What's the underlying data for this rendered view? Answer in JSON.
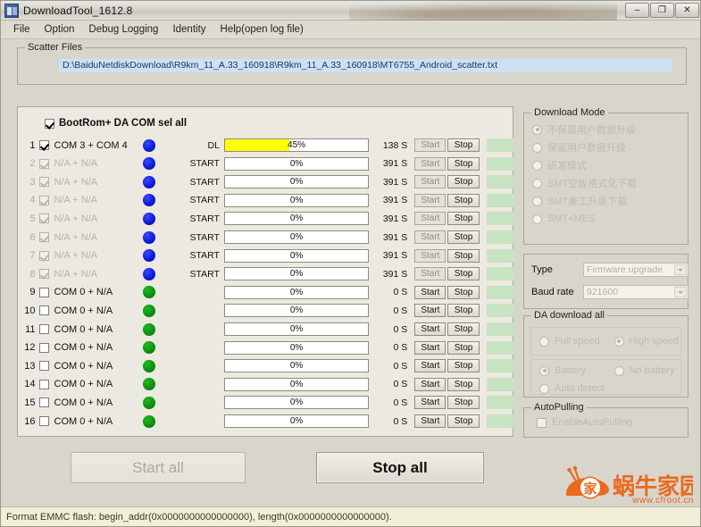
{
  "window": {
    "title": "DownloadTool_1612.8",
    "minimize_label": "–",
    "maximize_label": "❐",
    "close_label": "✕"
  },
  "menu": {
    "items": [
      {
        "label": "File"
      },
      {
        "label": "Option"
      },
      {
        "label": "Debug Logging"
      },
      {
        "label": "Identity"
      },
      {
        "label": "Help(open log file)"
      }
    ]
  },
  "scatter": {
    "group_label": "Scatter Files",
    "path": "D:\\BaiduNetdiskDownload\\R9km_11_A.33_160918\\R9km_11_A.33_160918\\MT6755_Android_scatter.txt"
  },
  "device_panel": {
    "select_all_label": "BootRom+ DA COM sel all",
    "select_all_checked": true,
    "rows": [
      {
        "index": "1",
        "checked": true,
        "dim": false,
        "port": "COM 3 + COM 4",
        "led": "blue",
        "action": "DL",
        "percent": "45%",
        "fill": 45,
        "filled": true,
        "time": "138 S",
        "start": "Start",
        "stop": "Stop",
        "start_enabled": false,
        "stop_enabled": true
      },
      {
        "index": "2",
        "checked": true,
        "dim": true,
        "port": "N/A + N/A",
        "led": "blue",
        "action": "START",
        "percent": "0%",
        "fill": 0,
        "filled": false,
        "time": "391 S",
        "start": "Start",
        "stop": "Stop",
        "start_enabled": false,
        "stop_enabled": true
      },
      {
        "index": "3",
        "checked": true,
        "dim": true,
        "port": "N/A + N/A",
        "led": "blue",
        "action": "START",
        "percent": "0%",
        "fill": 0,
        "filled": false,
        "time": "391 S",
        "start": "Start",
        "stop": "Stop",
        "start_enabled": false,
        "stop_enabled": true
      },
      {
        "index": "4",
        "checked": true,
        "dim": true,
        "port": "N/A + N/A",
        "led": "blue",
        "action": "START",
        "percent": "0%",
        "fill": 0,
        "filled": false,
        "time": "391 S",
        "start": "Start",
        "stop": "Stop",
        "start_enabled": false,
        "stop_enabled": true
      },
      {
        "index": "5",
        "checked": true,
        "dim": true,
        "port": "N/A + N/A",
        "led": "blue",
        "action": "START",
        "percent": "0%",
        "fill": 0,
        "filled": false,
        "time": "391 S",
        "start": "Start",
        "stop": "Stop",
        "start_enabled": false,
        "stop_enabled": true
      },
      {
        "index": "6",
        "checked": true,
        "dim": true,
        "port": "N/A + N/A",
        "led": "blue",
        "action": "START",
        "percent": "0%",
        "fill": 0,
        "filled": false,
        "time": "391 S",
        "start": "Start",
        "stop": "Stop",
        "start_enabled": false,
        "stop_enabled": true
      },
      {
        "index": "7",
        "checked": true,
        "dim": true,
        "port": "N/A + N/A",
        "led": "blue",
        "action": "START",
        "percent": "0%",
        "fill": 0,
        "filled": false,
        "time": "391 S",
        "start": "Start",
        "stop": "Stop",
        "start_enabled": false,
        "stop_enabled": true
      },
      {
        "index": "8",
        "checked": true,
        "dim": true,
        "port": "N/A + N/A",
        "led": "blue",
        "action": "START",
        "percent": "0%",
        "fill": 0,
        "filled": false,
        "time": "391 S",
        "start": "Start",
        "stop": "Stop",
        "start_enabled": false,
        "stop_enabled": true
      },
      {
        "index": "9",
        "checked": false,
        "dim": false,
        "port": "COM 0 + N/A",
        "led": "green",
        "action": "",
        "percent": "0%",
        "fill": 0,
        "filled": false,
        "time": "0 S",
        "start": "Start",
        "stop": "Stop",
        "start_enabled": true,
        "stop_enabled": true
      },
      {
        "index": "10",
        "checked": false,
        "dim": false,
        "port": "COM 0 + N/A",
        "led": "green",
        "action": "",
        "percent": "0%",
        "fill": 0,
        "filled": false,
        "time": "0 S",
        "start": "Start",
        "stop": "Stop",
        "start_enabled": true,
        "stop_enabled": true
      },
      {
        "index": "11",
        "checked": false,
        "dim": false,
        "port": "COM 0 + N/A",
        "led": "green",
        "action": "",
        "percent": "0%",
        "fill": 0,
        "filled": false,
        "time": "0 S",
        "start": "Start",
        "stop": "Stop",
        "start_enabled": true,
        "stop_enabled": true
      },
      {
        "index": "12",
        "checked": false,
        "dim": false,
        "port": "COM 0 + N/A",
        "led": "green",
        "action": "",
        "percent": "0%",
        "fill": 0,
        "filled": false,
        "time": "0 S",
        "start": "Start",
        "stop": "Stop",
        "start_enabled": true,
        "stop_enabled": true
      },
      {
        "index": "13",
        "checked": false,
        "dim": false,
        "port": "COM 0 + N/A",
        "led": "green",
        "action": "",
        "percent": "0%",
        "fill": 0,
        "filled": false,
        "time": "0 S",
        "start": "Start",
        "stop": "Stop",
        "start_enabled": true,
        "stop_enabled": true
      },
      {
        "index": "14",
        "checked": false,
        "dim": false,
        "port": "COM 0 + N/A",
        "led": "green",
        "action": "",
        "percent": "0%",
        "fill": 0,
        "filled": false,
        "time": "0 S",
        "start": "Start",
        "stop": "Stop",
        "start_enabled": true,
        "stop_enabled": true
      },
      {
        "index": "15",
        "checked": false,
        "dim": false,
        "port": "COM 0 + N/A",
        "led": "green",
        "action": "",
        "percent": "0%",
        "fill": 0,
        "filled": false,
        "time": "0 S",
        "start": "Start",
        "stop": "Stop",
        "start_enabled": true,
        "stop_enabled": true
      },
      {
        "index": "16",
        "checked": false,
        "dim": false,
        "port": "COM 0 + N/A",
        "led": "green",
        "action": "",
        "percent": "0%",
        "fill": 0,
        "filled": false,
        "time": "0 S",
        "start": "Start",
        "stop": "Stop",
        "start_enabled": true,
        "stop_enabled": true
      }
    ]
  },
  "actions": {
    "start_all": "Start all",
    "start_all_enabled": false,
    "stop_all": "Stop all",
    "stop_all_enabled": true
  },
  "download_mode": {
    "group_label": "Download Mode",
    "options": [
      {
        "label": "不保留用户数据升级",
        "selected": true
      },
      {
        "label": "保留用户数据升级",
        "selected": false
      },
      {
        "label": "研发模式",
        "selected": false
      },
      {
        "label": "SMT空板格式化下载",
        "selected": false
      },
      {
        "label": "SMT重工升级下载",
        "selected": false
      },
      {
        "label": "SMT+MES",
        "selected": false
      }
    ]
  },
  "type_panel": {
    "type_label": "Type",
    "type_value": "Firmware upgrade",
    "baud_label": "Baud rate",
    "baud_value": "921600"
  },
  "da_download": {
    "group_label": "DA download all",
    "speed_options": [
      {
        "label": "Full speed",
        "selected": false
      },
      {
        "label": "High speed",
        "selected": true
      }
    ],
    "battery_options": [
      {
        "label": "Battery",
        "selected": true
      },
      {
        "label": "No battery",
        "selected": false
      },
      {
        "label": "Auto detect",
        "selected": false
      }
    ]
  },
  "autopulling": {
    "group_label": "AutoPulling",
    "checkbox_label": "EnableAutoPulling",
    "checked": false
  },
  "statusbar": {
    "text": "Format EMMC flash:  begin_addr(0x0000000000000000), length(0x0000000000000000)."
  },
  "logo": {
    "brand": "蜗牛家园",
    "url": "www.cfroot.cn",
    "color": "#ea6a1e"
  }
}
